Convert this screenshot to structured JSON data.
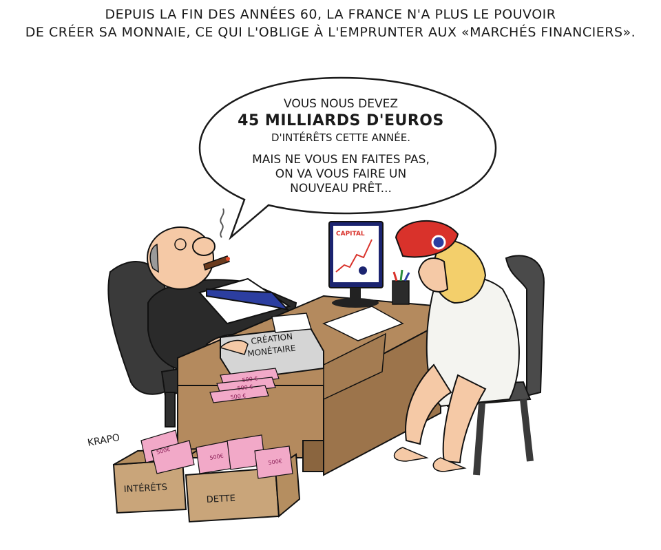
{
  "caption": {
    "line1": "DEPUIS LA FIN DES ANNÉES 60, LA FRANCE N'A PLUS LE POUVOIR",
    "line2": "DE CRÉER SA MONNAIE, CE QUI L'OBLIGE À L'EMPRUNTER AUX «MARCHÉS FINANCIERS»."
  },
  "speech": {
    "line1": "VOUS NOUS DEVEZ",
    "line2": "45 MILLIARDS D'EUROS",
    "line3": "D'INTÉRÊTS CETTE ANNÉE.",
    "line4": "MAIS NE VOUS EN FAITES PAS,",
    "line5": "ON VA VOUS FAIRE UN",
    "line6": "NOUVEAU PRÊT..."
  },
  "monitor": {
    "label": "CAPITAL"
  },
  "printer": {
    "line1": "CRÉATION",
    "line2": "MONÉTAIRE"
  },
  "banknote": {
    "value": "500 €",
    "value_short": "500€"
  },
  "boxes": {
    "left": "INTÉRÊTS",
    "right": "DETTE"
  },
  "signature": "KRAPO",
  "colors": {
    "beret": "#d9322b",
    "note": "#f2a9c8",
    "note_dark": "#c0528b",
    "desk": "#b48a5e",
    "chair": "#3a3a3a",
    "skin": "#f5c9a6",
    "hair": "#f3cf6b",
    "box": "#c9a57a",
    "tie": "#2c3ea0"
  }
}
